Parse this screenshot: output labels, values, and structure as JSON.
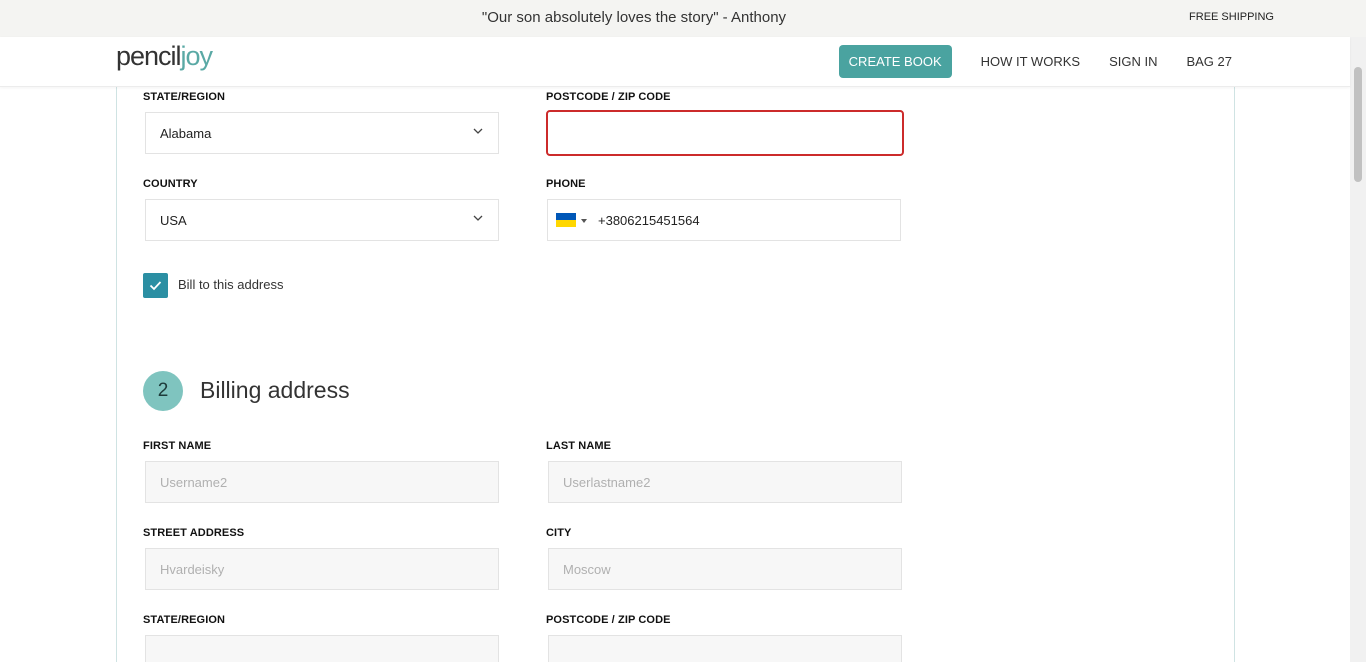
{
  "promo": {
    "quote": "\"Our son absolutely loves the story\" - Anthony",
    "shipping": "FREE SHIPPING"
  },
  "header": {
    "logo_pencil": "pencil",
    "logo_joy": "joy",
    "create_book": "CREATE BOOK",
    "how_it_works": "HOW IT WORKS",
    "sign_in": "SIGN IN",
    "bag": "BAG 27"
  },
  "shipping": {
    "state_label": "STATE/REGION",
    "state_value": "Alabama",
    "postcode_label": "POSTCODE / ZIP CODE",
    "postcode_value": "",
    "country_label": "COUNTRY",
    "country_value": "USA",
    "phone_label": "PHONE",
    "phone_value": "+3806215451564",
    "phone_flag": "ukraine-flag",
    "bill_to_label": "Bill to this address",
    "bill_to_checked": true
  },
  "billing": {
    "step_number": "2",
    "title": "Billing address",
    "first_name_label": "FIRST NAME",
    "first_name_value": "Username2",
    "last_name_label": "LAST NAME",
    "last_name_value": "Userlastname2",
    "street_label": "STREET ADDRESS",
    "street_value": "Hvardeisky",
    "city_label": "CITY",
    "city_value": "Moscow",
    "state_label": "STATE/REGION",
    "postcode_label": "POSTCODE / ZIP CODE"
  },
  "colors": {
    "accent": "#4aa3a0",
    "checkbox": "#2b8fa3",
    "error": "#cc2b2b",
    "step_circle": "#7fc4bf"
  }
}
